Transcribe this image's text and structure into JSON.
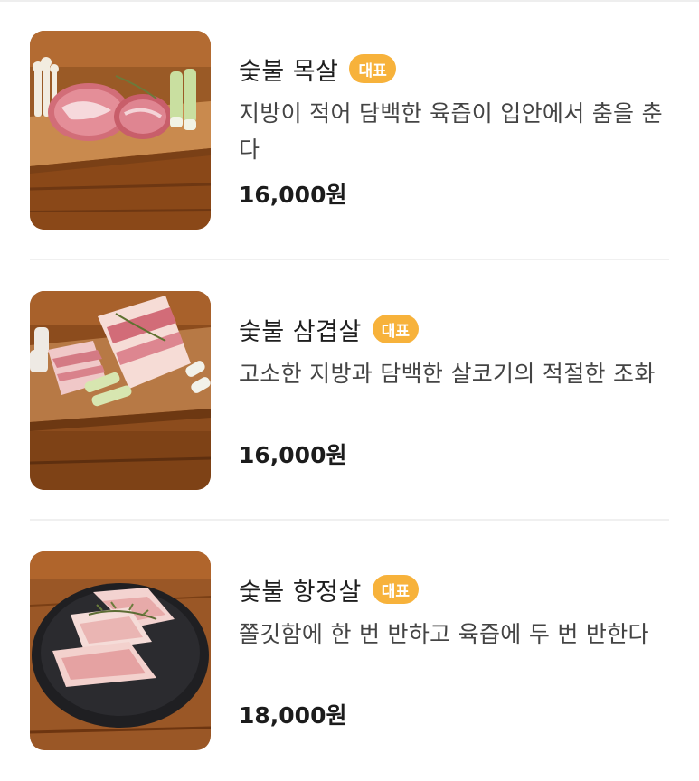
{
  "menu": {
    "items": [
      {
        "name": "숯불 목살",
        "badge": "대표",
        "description": "지방이 적어 담백한 육즙이 입안에서 춤을 춘다",
        "price": "16,000원",
        "image": "meat-on-board-icon"
      },
      {
        "name": "숯불 삼겹살",
        "badge": "대표",
        "description": "고소한 지방과 담백한 살코기의 적절한 조화",
        "price": "16,000원",
        "image": "pork-belly-on-board-icon"
      },
      {
        "name": "숯불 항정살",
        "badge": "대표",
        "description": "쫄깃함에 한 번 반하고 육즙에 두 번 반한다",
        "price": "18,000원",
        "image": "meat-on-plate-icon"
      }
    ]
  },
  "colors": {
    "badge": "#f7b23b",
    "wood": "#8a4e1f",
    "divider": "#f0f0f0"
  }
}
